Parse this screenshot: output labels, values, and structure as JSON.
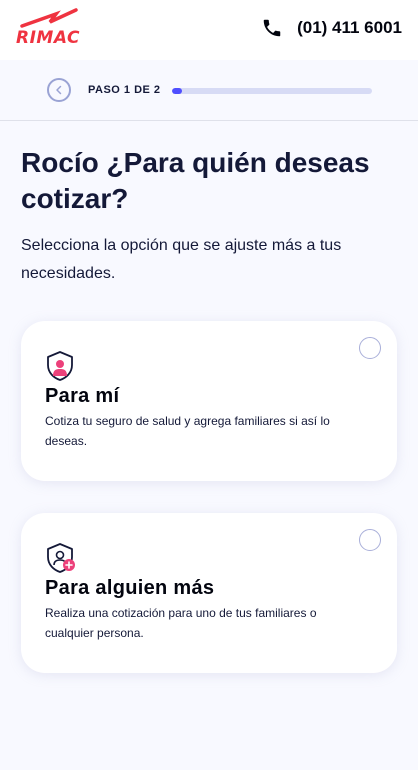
{
  "header": {
    "logo_text": "RIMAC",
    "phone_icon": "phone-icon",
    "phone_number": "(01) 411 6001"
  },
  "stepper": {
    "back_icon": "chevron-left-icon",
    "label": "PASO 1 DE 2",
    "progress": 0.05,
    "accent_color": "#4f4fff",
    "track_color": "#d7dbf5"
  },
  "main": {
    "title": "Rocío ¿Para quién deseas cotizar?",
    "subtitle": "Selecciona la opción que se ajuste más a tus necesidades."
  },
  "options": [
    {
      "icon": "shield-user-icon",
      "title": "Para mí",
      "description": "Cotiza tu seguro de salud y agrega familiares si así lo deseas.",
      "selected": false
    },
    {
      "icon": "shield-user-add-icon",
      "title": "Para alguien más",
      "description": "Realiza una cotización para uno de tus familiares o cualquier persona.",
      "selected": false
    }
  ],
  "colors": {
    "brand": "#ef3340",
    "background": "#f8f9ff",
    "text": "#141938",
    "icon_accent": "#ec407a"
  }
}
